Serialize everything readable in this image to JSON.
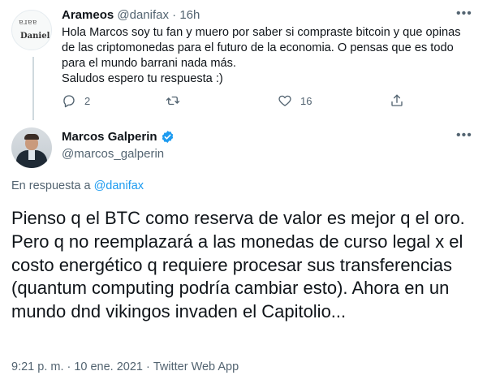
{
  "reply_tweet": {
    "avatar_text_top": "ɐɹɐɐ",
    "avatar_text_name": "Daniel",
    "display_name": "Arameos",
    "handle": "@danifax",
    "time": "16h",
    "text": "Hola Marcos  soy tu fan y muero por saber si compraste bitcoin y que opinas de las criptomonedas para el futuro de la economia. O pensas que es todo para el mundo barrani nada más.\nSaludos espero tu respuesta :)",
    "reply_count": "2",
    "like_count": "16"
  },
  "main_tweet": {
    "display_name": "Marcos Galperin",
    "handle": "@marcos_galperin",
    "in_reply_prefix": "En respuesta a",
    "in_reply_handle": "@danifax",
    "text": "Pienso q el BTC como reserva de valor es mejor q el oro. Pero q no reemplazará a las monedas de curso legal x el costo energético q requiere procesar sus transferencias (quantum computing podría cambiar esto). Ahora en un mundo dnd vikingos invaden el Capitolio...",
    "time": "9:21 p. m.",
    "date": "10 ene. 2021",
    "source": "Twitter Web App"
  },
  "icons": {
    "more": "more-dots-icon",
    "reply": "reply-bubble-icon",
    "retweet": "retweet-icon",
    "like": "heart-icon",
    "share": "share-icon",
    "verified": "verified-badge-icon"
  },
  "colors": {
    "accent": "#1d9bf0",
    "secondary_text": "#536471",
    "primary_text": "#0f1419",
    "thread_line": "#cfd9de"
  }
}
